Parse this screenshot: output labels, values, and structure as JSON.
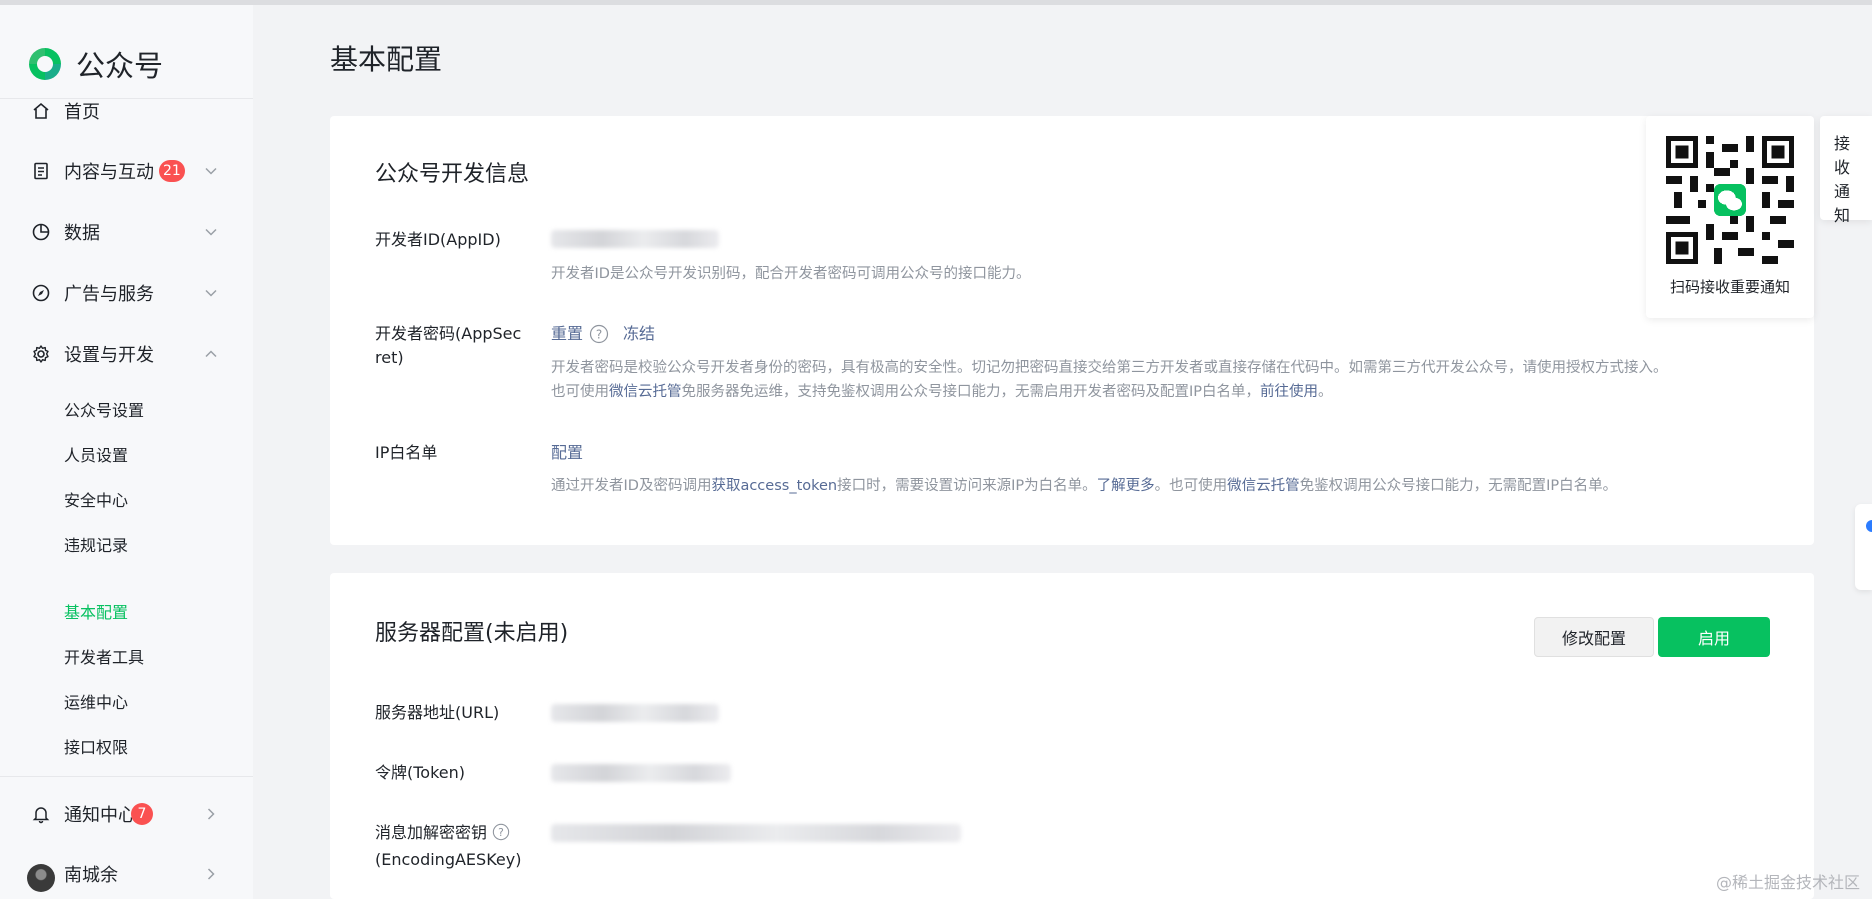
{
  "app": {
    "name": "公众号"
  },
  "sidebar": {
    "home": {
      "label": "首页",
      "icon": "home-icon"
    },
    "content": {
      "label": "内容与互动",
      "badge": "21",
      "icon": "document-icon"
    },
    "data": {
      "label": "数据",
      "icon": "pie-chart-icon"
    },
    "ads": {
      "label": "广告与服务",
      "icon": "compass-icon"
    },
    "settings": {
      "label": "设置与开发",
      "icon": "gear-icon",
      "expanded": true,
      "group1": [
        "公众号设置",
        "人员设置",
        "安全中心",
        "违规记录"
      ],
      "group2": [
        "基本配置",
        "开发者工具",
        "运维中心",
        "接口权限"
      ],
      "active": "基本配置"
    },
    "notifications": {
      "label": "通知中心",
      "badge": "7",
      "icon": "bell-icon"
    },
    "user": {
      "name": "南城余"
    }
  },
  "main": {
    "title": "基本配置",
    "dev_info": {
      "title": "公众号开发信息",
      "appid": {
        "label": "开发者ID(AppID)",
        "desc": "开发者ID是公众号开发识别码，配合开发者密码可调用公众号的接口能力。"
      },
      "secret": {
        "label_line1": "开发者密码(AppSec",
        "label_line2": "ret)",
        "reset": "重置",
        "freeze": "冻结",
        "desc1": "开发者密码是校验公众号开发者身份的密码，具有极高的安全性。切记勿把密码直接交给第三方开发者或直接存储在代码中。如需第三方代开发公众号，请使用授权方式接入。",
        "desc2_a": "也可使用",
        "desc2_link1": "微信云托管",
        "desc2_b": "免服务器免运维，支持免鉴权调用公众号接口能力，无需启用开发者密码及配置IP白名单，",
        "desc2_link2": "前往使用",
        "desc2_c": "。"
      },
      "ip": {
        "label": "IP白名单",
        "config": "配置",
        "desc_a": "通过开发者ID及密码调用",
        "desc_link1": "获取access_token",
        "desc_b": "接口时，需要设置访问来源IP为白名单。",
        "desc_link2": "了解更多",
        "desc_c": "。也可使用",
        "desc_link3": "微信云托管",
        "desc_d": "免鉴权调用公众号接口能力，无需配置IP白名单。"
      }
    },
    "server": {
      "title": "服务器配置(未启用)",
      "edit_button": "修改配置",
      "enable_button": "启用",
      "url_label": "服务器地址(URL)",
      "token_label": "令牌(Token)",
      "aes_label_line1": "消息加解密密钥",
      "aes_label_line2": "(EncodingAESKey)"
    }
  },
  "qr_panel": {
    "text": "扫码接收重要通知"
  },
  "side_tab": {
    "text": "接收通知"
  },
  "watermark": "@稀土掘金技术社区",
  "colors": {
    "brand_green": "#07c160",
    "badge_red": "#fa5151",
    "link_blue": "#576b95"
  }
}
